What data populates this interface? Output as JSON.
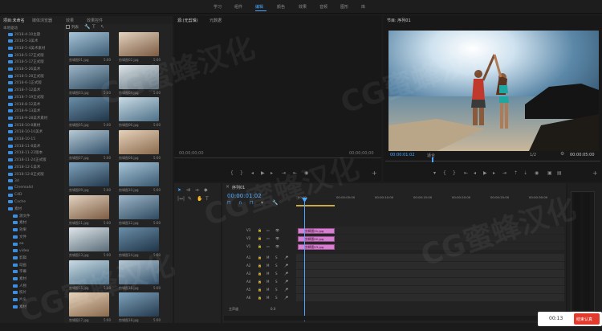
{
  "workspaces": [
    "学习",
    "组件",
    "编辑",
    "颜色",
    "效果",
    "音频",
    "图形",
    "库"
  ],
  "project": {
    "tabs": [
      "项目:未命名",
      "媒体浏览器",
      "效果",
      "效果控件"
    ],
    "tree_header": "本地驱动",
    "tree_items": [
      "2018-4-10主题",
      "2018-5-3美术",
      "2018-5-4美术素材",
      "2018-5-17正式版",
      "2018-5-17正式版",
      "2018-5-26美术",
      "2018-5-28正式版",
      "2018-6-1正式版",
      "2018-7-12美术",
      "2018-7-19正式版",
      "2018-8-12美术",
      "2018-9-13美术",
      "2018-9-28美术素材",
      "2018-10-8素材",
      "2018-10-10美术",
      "2018-10-15",
      "2018-11-8美术",
      "2018-11-22版本",
      "2018-11-24正式版",
      "2018-12-1美术",
      "2018-12-8正式版",
      "3d",
      "Cinema4d",
      "C4D",
      "Cache",
      "素材",
      "源文件",
      "素材",
      "效果",
      "文件",
      "aa",
      "video",
      "剪辑",
      "动画",
      "字幕",
      "素材",
      "人物",
      "照片",
      "片头",
      "素材"
    ],
    "checkbox_label": "列表",
    "thumbs": [
      {
        "label": "剪辑图01.jpg",
        "dur": "5:00"
      },
      {
        "label": "剪辑图02.jpg",
        "dur": "5:00"
      },
      {
        "label": "剪辑图03.jpg",
        "dur": "5:00"
      },
      {
        "label": "剪辑图04.jpg",
        "dur": "5:00"
      },
      {
        "label": "剪辑图05.jpg",
        "dur": "5:00"
      },
      {
        "label": "剪辑图06.jpg",
        "dur": "5:00"
      },
      {
        "label": "剪辑图07.jpg",
        "dur": "5:00"
      },
      {
        "label": "剪辑图08.jpg",
        "dur": "5:00"
      },
      {
        "label": "剪辑图09.jpg",
        "dur": "5:00"
      },
      {
        "label": "剪辑图10.jpg",
        "dur": "5:00"
      },
      {
        "label": "剪辑图11.jpg",
        "dur": "5:00"
      },
      {
        "label": "剪辑图12.jpg",
        "dur": "5:00"
      },
      {
        "label": "剪辑图13.jpg",
        "dur": "5:00"
      },
      {
        "label": "剪辑图14.jpg",
        "dur": "5:00"
      },
      {
        "label": "剪辑图15.jpg",
        "dur": "5:00"
      },
      {
        "label": "剪辑图16.jpg",
        "dur": "5:00"
      },
      {
        "label": "剪辑图17.jpg",
        "dur": "5:00"
      },
      {
        "label": "剪辑图18.jpg",
        "dur": "5:00"
      }
    ]
  },
  "source": {
    "title": "源:(无剪辑)",
    "tab2": "元数据",
    "tc_left": "00;00;00;00",
    "tc_right": "00;00;00;00"
  },
  "program": {
    "title": "节目: 序列01",
    "tc_left": "00:00:01:02",
    "fit": "适合",
    "ratio": "1/2",
    "tc_right": "00:00:05:00"
  },
  "timeline": {
    "title": "序列01",
    "timecode": "00:00:01:02",
    "ruler": [
      "00:00",
      "00:00:05:00",
      "00:00:10:00",
      "00:00:15:00",
      "00:00:20:00",
      "00:00:25:00",
      "00:00:30:00"
    ],
    "video_tracks": [
      "V3",
      "V2",
      "V1"
    ],
    "audio_tracks": [
      "A1",
      "A2",
      "A3",
      "A4",
      "A5",
      "A6"
    ],
    "master": "主声道",
    "master_val": "0.0",
    "clips": [
      "剪辑图01.jpg",
      "剪辑图02.jpg",
      "剪辑图03.jpg"
    ]
  },
  "badge": {
    "time": "00:13",
    "label": "结束认真"
  },
  "watermark": "CG蜜蜂汉化"
}
